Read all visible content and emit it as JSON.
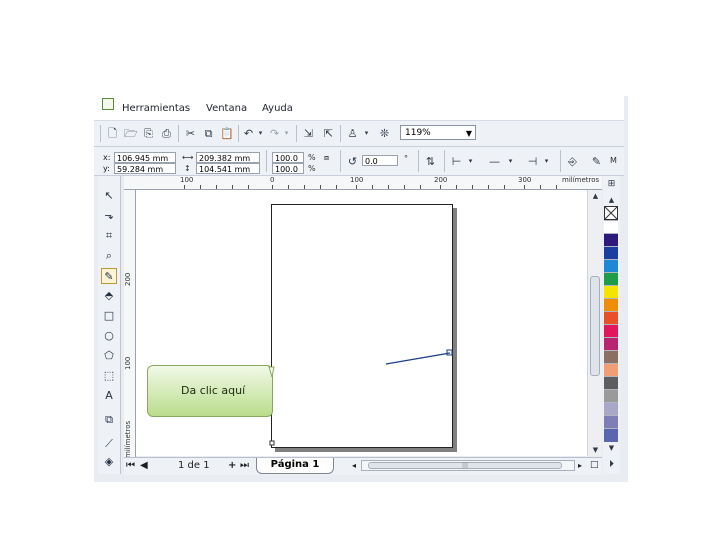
{
  "menu": {
    "items": [
      "Herramientas",
      "Ventana",
      "Ayuda"
    ]
  },
  "toolbar": {
    "zoom_value": "119%"
  },
  "properties": {
    "x_label": "x:",
    "x_value": "106.945 mm",
    "y_label": "y:",
    "y_value": "59.284 mm",
    "width_value": "209.382 mm",
    "height_value": "104.541 mm",
    "scale_x": "100.0",
    "scale_y": "100.0",
    "percent_symbol": "%",
    "rotation_value": "0.0",
    "degree_symbol": "°",
    "extra_label": "M"
  },
  "ruler": {
    "h_ticks": [
      "100",
      "0",
      "100",
      "200",
      "300"
    ],
    "units": "milímetros",
    "v_ticks": [
      "200",
      "100"
    ],
    "v_units": "milímetros"
  },
  "statusbar": {
    "page_count": "1 de 1",
    "page_tab": "Página 1"
  },
  "callout": {
    "text": "Da clic aquí"
  },
  "palette": {
    "colors": [
      "#ffffff",
      "#2d1a7a",
      "#1a3fa0",
      "#1e88d6",
      "#1e9c4a",
      "#f5e400",
      "#f08c00",
      "#e8502a",
      "#e2165a",
      "#b8246f",
      "#8a7060",
      "#f29e74",
      "#5e5e5e",
      "#9a9a9a",
      "#a9a6c9",
      "#7f7fb5",
      "#5a67b0"
    ]
  }
}
